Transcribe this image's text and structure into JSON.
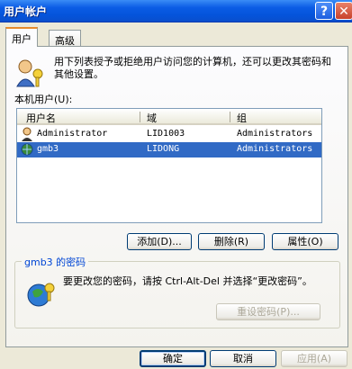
{
  "window": {
    "title": "用户帐户",
    "help_button": "?",
    "close_button": "✕"
  },
  "tabs": [
    {
      "label": "用户",
      "active": true
    },
    {
      "label": "高级",
      "active": false
    }
  ],
  "intro_text": "用下列表授予或拒绝用户访问您的计算机，还可以更改其密码和其他设置。",
  "list_label": "本机用户(U):",
  "columns": {
    "user": "用户名",
    "domain": "域",
    "group": "组"
  },
  "rows": [
    {
      "user": "Administrator",
      "domain": "LID1003",
      "group": "Administrators",
      "selected": false
    },
    {
      "user": "gmb3",
      "domain": "LIDONG",
      "group": "Administrators",
      "selected": true
    }
  ],
  "buttons": {
    "add": "添加(D)...",
    "remove": "删除(R)",
    "properties": "属性(O)"
  },
  "password_group": {
    "label": "gmb3 的密码",
    "text": "要更改您的密码，请按 Ctrl-Alt-Del 并选择“更改密码”。",
    "reset_button": "重设密码(P)..."
  },
  "footer": {
    "ok": "确定",
    "cancel": "取消",
    "apply": "应用(A)"
  },
  "colors": {
    "selection": "#316AC5",
    "title_bar": "#0454DB",
    "tab_highlight": "#E68B2C"
  }
}
